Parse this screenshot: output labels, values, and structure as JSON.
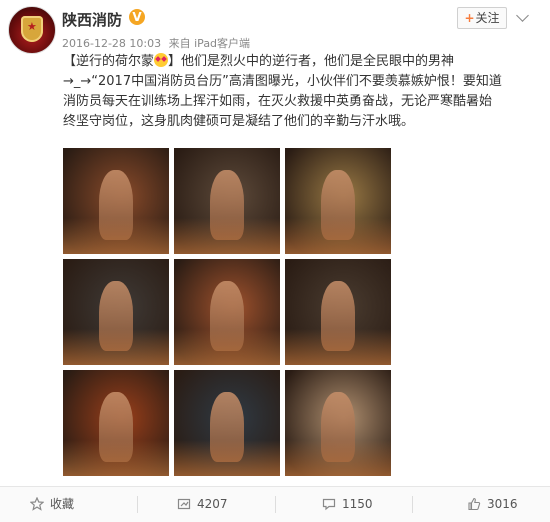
{
  "user": {
    "name": "陕西消防",
    "verified_mark": "V",
    "timestamp": "2016-12-28 10:03",
    "source": "来自 iPad客户端",
    "follow_label": "关注"
  },
  "post": {
    "text_a": "【逆行的荷尔蒙",
    "text_b": "】他们是烈火中的逆行者，他们是全民眼中的男神→_→“2017中国消防员台历”高清图曝光，小伙伴们不要羡慕嫉妒恨！要知道消防员每天在训练场上挥汗如雨，在灭火救援中英勇奋战，无论严寒酷暑始终坚守岗位，这身肌肉健硕可是凝结了他们的辛勤与汗水哦。"
  },
  "photos": [
    {
      "label": "firefighter-ladder",
      "tone": "#8a4b2a"
    },
    {
      "label": "firefighter-with-dog",
      "tone": "#5d4a3a"
    },
    {
      "label": "firefighter-portrait",
      "tone": "#9a7a45"
    },
    {
      "label": "firefighter-helmet",
      "tone": "#3f3a36"
    },
    {
      "label": "firefighters-group-smoke",
      "tone": "#a0522d"
    },
    {
      "label": "firefighter-seated",
      "tone": "#4a3c30"
    },
    {
      "label": "firefighters-fire",
      "tone": "#9b3f1a"
    },
    {
      "label": "firefighters-truck",
      "tone": "#2f3a44"
    },
    {
      "label": "firefighter-calendar",
      "tone": "#b09070"
    }
  ],
  "actions": {
    "favorite_label": "收藏",
    "repost_count": "4207",
    "comment_count": "1150",
    "like_count": "3016"
  },
  "colors": {
    "accent": "#f77c3d",
    "verified": "#f5a623",
    "text": "#333333",
    "meta": "#888888"
  }
}
